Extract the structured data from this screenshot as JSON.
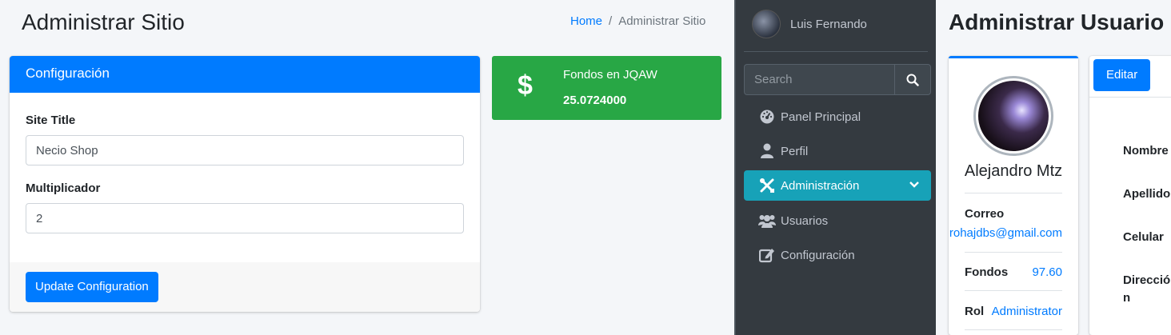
{
  "left_page": {
    "title": "Administrar Sitio",
    "breadcrumb": {
      "home": "Home",
      "separator": "/",
      "current": "Administrar Sitio"
    }
  },
  "config_card": {
    "header": "Configuración",
    "site_title_label": "Site Title",
    "site_title_value": "Necio Shop",
    "multiplier_label": "Multiplicador",
    "multiplier_value": "2",
    "submit_label": "Update Configuration"
  },
  "funds_box": {
    "icon": "dollar-icon",
    "icon_glyph": "$",
    "label": "Fondos en JQAW",
    "value": "25.0724000"
  },
  "sidebar": {
    "user_name": "Luis Fernando",
    "search_placeholder": "Search",
    "items": [
      {
        "label": "Panel Principal",
        "icon": "tachometer-icon"
      },
      {
        "label": "Perfil",
        "icon": "user-icon"
      },
      {
        "label": "Administración",
        "icon": "tools-icon",
        "active": true
      },
      {
        "label": "Usuarios",
        "icon": "users-icon"
      },
      {
        "label": "Configuración",
        "icon": "edit-icon"
      }
    ]
  },
  "right_page": {
    "title": "Administrar Usuario",
    "profile": {
      "name": "Alejandro Mtz",
      "email_label": "Correo",
      "email_value": "alejandrohajdbs@gmail.com",
      "funds_label": "Fondos",
      "funds_value": "97.60",
      "role_label": "Rol",
      "role_value": "Administrator"
    },
    "edit_tab": "Editar",
    "fields": {
      "name": "Nombre",
      "surname": "Apellido",
      "phone": "Celular",
      "address": "Dirección"
    }
  },
  "colors": {
    "primary": "#007bff",
    "success": "#28a745",
    "info_active": "#17a2b8",
    "sidebar_bg": "#343a40",
    "page_bg": "#f4f6f9"
  }
}
